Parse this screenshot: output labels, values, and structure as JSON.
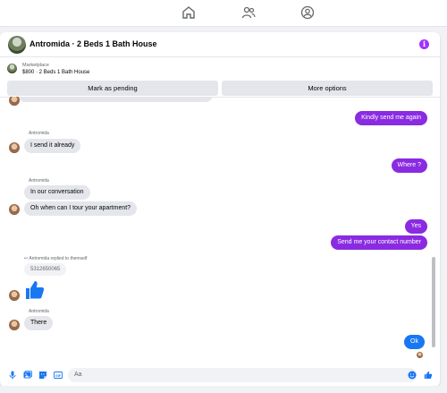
{
  "topnav": {
    "items": [
      {
        "icon": "home-icon"
      },
      {
        "icon": "people-icon"
      },
      {
        "icon": "profile-circle-icon"
      }
    ]
  },
  "header": {
    "title": "Antromida · 2 Beds 1 Bath House",
    "info_icon": "info-icon",
    "info_glyph": "i"
  },
  "listing": {
    "subtitle": "Marketplace",
    "price_line": "$800 · 2 Beds 1 Bath House"
  },
  "actions": {
    "mark_pending": "Mark as pending",
    "more_options": "More options"
  },
  "messages": {
    "out_1": "Kindly send me again",
    "sender_1": "Antromida",
    "in_1": "I send it already",
    "out_2": "Where ?",
    "sender_2": "Antromida",
    "in_2": "In our conversation",
    "in_3": "Oh when can I tour your apartment?",
    "out_3": "Yes",
    "out_4": "Send me your contact number",
    "reply_note": "Antromida replied to themself",
    "reply_quote": "5312650065",
    "sender_3": "Antromida",
    "in_4": "There",
    "out_5": "Ok"
  },
  "composer": {
    "placeholder": "Aa"
  },
  "colors": {
    "outgoing": "#8a2be2",
    "outgoing_last": "#1877f2",
    "incoming": "#e4e6eb",
    "accent": "#1877f2"
  }
}
